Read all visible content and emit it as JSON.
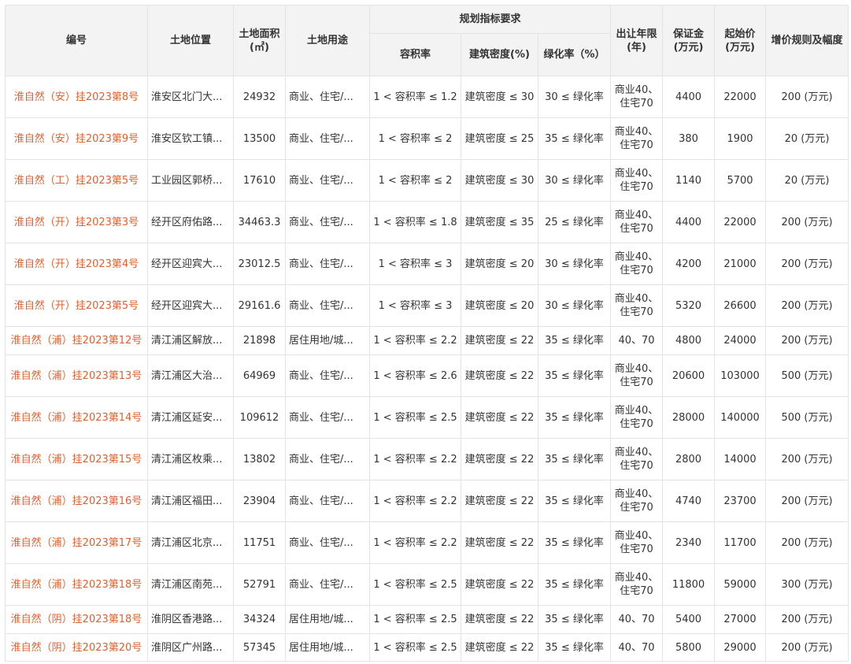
{
  "table": {
    "headers": {
      "id": "编号",
      "location": "土地位置",
      "area": "土地面积(㎡)",
      "usage": "土地用途",
      "group": "规划指标要求",
      "far": "容积率",
      "density": "建筑密度(%)",
      "green": "绿化率（%）",
      "years": "出让年限(年)",
      "deposit": "保证金(万元)",
      "start_price": "起始价(万元)",
      "increment": "增价规则及幅度"
    },
    "rows": [
      {
        "id": "淮自然（安）挂2023第8号",
        "location": "淮安区北门大...",
        "area": "24932",
        "usage": "商业、住宅/...",
        "far": "1 < 容积率 ≤ 1.2",
        "density": "建筑密度 ≤ 30",
        "green": "30 ≤ 绿化率",
        "years": "商业40、住宅70",
        "deposit": "4400",
        "start_price": "22000",
        "increment": "200 (万元)"
      },
      {
        "id": "淮自然（安）挂2023第9号",
        "location": "淮安区钦工镇...",
        "area": "13500",
        "usage": "商业、住宅/...",
        "far": "1 < 容积率 ≤ 2",
        "density": "建筑密度 ≤ 25",
        "green": "35 ≤ 绿化率",
        "years": "商业40、住宅70",
        "deposit": "380",
        "start_price": "1900",
        "increment": "20 (万元)"
      },
      {
        "id": "淮自然（工）挂2023第5号",
        "location": "工业园区郭桥...",
        "area": "17610",
        "usage": "商业、住宅/...",
        "far": "1 < 容积率 ≤ 2",
        "density": "建筑密度 ≤ 30",
        "green": "30 ≤ 绿化率",
        "years": "商业40、住宅70",
        "deposit": "1140",
        "start_price": "5700",
        "increment": "20 (万元)"
      },
      {
        "id": "淮自然（开）挂2023第3号",
        "location": "经开区府佑路...",
        "area": "34463.3",
        "usage": "商业、住宅/...",
        "far": "1 < 容积率 ≤ 1.8",
        "density": "建筑密度 ≤ 35",
        "green": "25 ≤ 绿化率",
        "years": "商业40、住宅70",
        "deposit": "4400",
        "start_price": "22000",
        "increment": "200 (万元)"
      },
      {
        "id": "淮自然（开）挂2023第4号",
        "location": "经开区迎宾大...",
        "area": "23012.5",
        "usage": "商业、住宅/...",
        "far": "1 < 容积率 ≤ 3",
        "density": "建筑密度 ≤ 20",
        "green": "30 ≤ 绿化率",
        "years": "商业40、住宅70",
        "deposit": "4200",
        "start_price": "21000",
        "increment": "200 (万元)"
      },
      {
        "id": "淮自然（开）挂2023第5号",
        "location": "经开区迎宾大...",
        "area": "29161.6",
        "usage": "商业、住宅/...",
        "far": "1 < 容积率 ≤ 3",
        "density": "建筑密度 ≤ 20",
        "green": "30 ≤ 绿化率",
        "years": "商业40、住宅70",
        "deposit": "5320",
        "start_price": "26600",
        "increment": "200 (万元)"
      },
      {
        "id": "淮自然（浦）挂2023第12号",
        "location": "清江浦区解放...",
        "area": "21898",
        "usage": "居住用地/城...",
        "far": "1 < 容积率 ≤ 2.2",
        "density": "建筑密度 ≤ 22",
        "green": "35 ≤ 绿化率",
        "years": "40、70",
        "deposit": "4800",
        "start_price": "24000",
        "increment": "200 (万元)"
      },
      {
        "id": "淮自然（浦）挂2023第13号",
        "location": "清江浦区大治...",
        "area": "64969",
        "usage": "商业、住宅/...",
        "far": "1 < 容积率 ≤ 2.6",
        "density": "建筑密度 ≤ 22",
        "green": "35 ≤ 绿化率",
        "years": "商业40、住宅70",
        "deposit": "20600",
        "start_price": "103000",
        "increment": "500 (万元)"
      },
      {
        "id": "淮自然（浦）挂2023第14号",
        "location": "清江浦区延安...",
        "area": "109612",
        "usage": "商业、住宅/...",
        "far": "1 < 容积率 ≤ 2.5",
        "density": "建筑密度 ≤ 22",
        "green": "35 ≤ 绿化率",
        "years": "商业40、住宅70",
        "deposit": "28000",
        "start_price": "140000",
        "increment": "500 (万元)"
      },
      {
        "id": "淮自然（浦）挂2023第15号",
        "location": "清江浦区枚乘...",
        "area": "13802",
        "usage": "商业、住宅/...",
        "far": "1 < 容积率 ≤ 2.2",
        "density": "建筑密度 ≤ 22",
        "green": "35 ≤ 绿化率",
        "years": "商业40、住宅70",
        "deposit": "2800",
        "start_price": "14000",
        "increment": "200 (万元)"
      },
      {
        "id": "淮自然（浦）挂2023第16号",
        "location": "清江浦区福田...",
        "area": "23904",
        "usage": "商业、住宅/...",
        "far": "1 < 容积率 ≤ 2.2",
        "density": "建筑密度 ≤ 22",
        "green": "35 ≤ 绿化率",
        "years": "商业40、住宅70",
        "deposit": "4740",
        "start_price": "23700",
        "increment": "200 (万元)"
      },
      {
        "id": "淮自然（浦）挂2023第17号",
        "location": "清江浦区北京...",
        "area": "11751",
        "usage": "商业、住宅/...",
        "far": "1 < 容积率 ≤ 2.2",
        "density": "建筑密度 ≤ 22",
        "green": "35 ≤ 绿化率",
        "years": "商业40、住宅70",
        "deposit": "2340",
        "start_price": "11700",
        "increment": "200 (万元)"
      },
      {
        "id": "淮自然（浦）挂2023第18号",
        "location": "清江浦区南苑...",
        "area": "52791",
        "usage": "商业、住宅/...",
        "far": "1 < 容积率 ≤ 2.5",
        "density": "建筑密度 ≤ 22",
        "green": "35 ≤ 绿化率",
        "years": "商业40、住宅70",
        "deposit": "11800",
        "start_price": "59000",
        "increment": "300 (万元)"
      },
      {
        "id": "淮自然（阴）挂2023第18号",
        "location": "淮阴区香港路...",
        "area": "34324",
        "usage": "居住用地/城...",
        "far": "1 < 容积率 ≤ 2.5",
        "density": "建筑密度 ≤ 22",
        "green": "35 ≤ 绿化率",
        "years": "40、70",
        "deposit": "5400",
        "start_price": "27000",
        "increment": "200 (万元)"
      },
      {
        "id": "淮自然（阴）挂2023第20号",
        "location": "淮阴区广州路...",
        "area": "57345",
        "usage": "居住用地/城...",
        "far": "1 < 容积率 ≤ 2.5",
        "density": "建筑密度 ≤ 22",
        "green": "35 ≤ 绿化率",
        "years": "40、70",
        "deposit": "5800",
        "start_price": "29000",
        "increment": "200 (万元)"
      }
    ]
  },
  "colors": {
    "id_link": "#e0602e",
    "header_bg": "#f3f3f3",
    "border": "#e3e3e3",
    "text": "#333333"
  }
}
